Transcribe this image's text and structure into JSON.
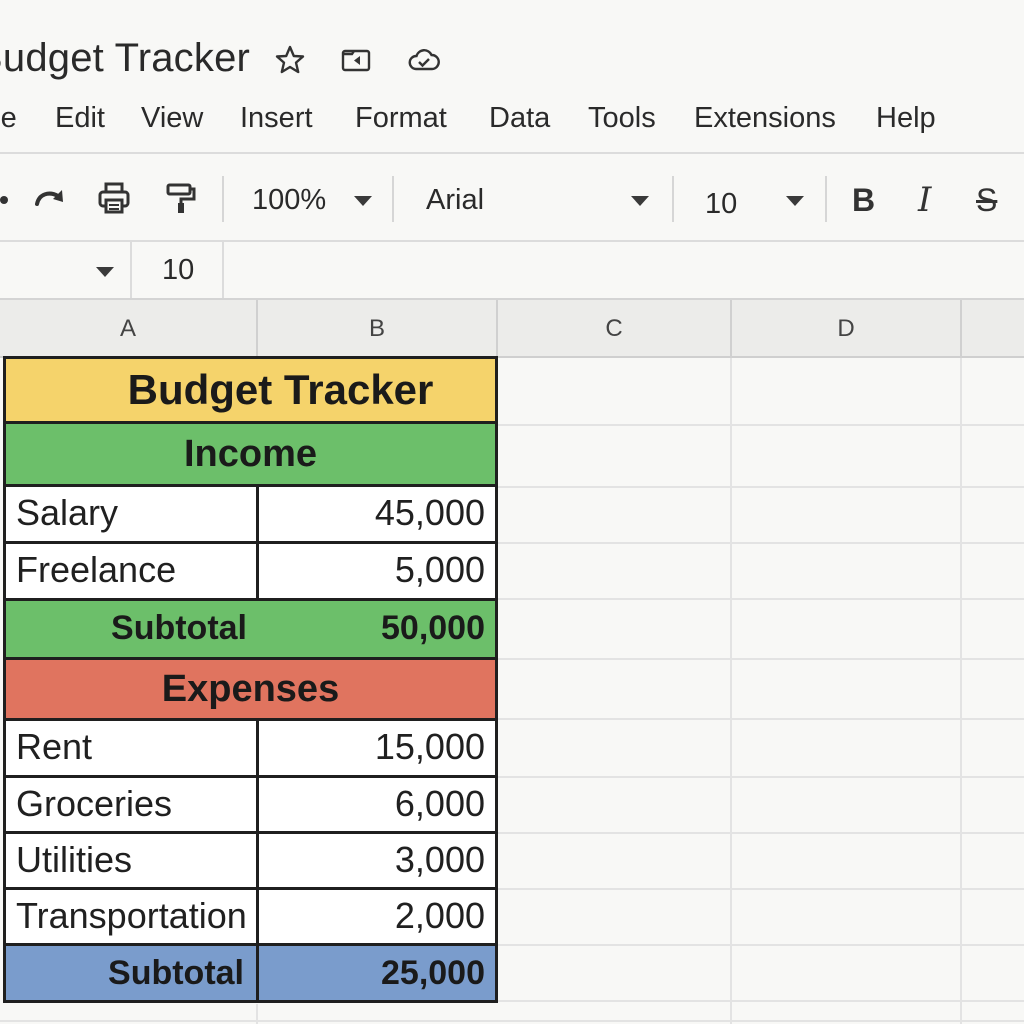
{
  "app": {
    "doc_title": "Budget Tracker",
    "title_icons": [
      "star-icon",
      "move-to-folder-icon",
      "cloud-saved-icon"
    ]
  },
  "menu": {
    "items": [
      "File",
      "Edit",
      "View",
      "Insert",
      "Format",
      "Data",
      "Tools",
      "Extensions",
      "Help"
    ]
  },
  "toolbar": {
    "icons": [
      "undo-icon",
      "redo-icon",
      "print-icon",
      "paint-format-icon"
    ],
    "zoom": "100%",
    "font_family": "Arial",
    "font_size": "10",
    "bold_label": "B",
    "italic_label": "I",
    "strikethrough_label": "S"
  },
  "formula_bar": {
    "cell_name": "",
    "value": "10"
  },
  "grid": {
    "columns": [
      "A",
      "B",
      "C",
      "D"
    ]
  },
  "budget": {
    "title": "Budget Tracker",
    "income_header": "Income",
    "income_rows": [
      {
        "label": "Salary",
        "value": "45,000"
      },
      {
        "label": "Freelance",
        "value": "5,000"
      }
    ],
    "income_subtotal": {
      "label": "Subtotal",
      "value": "50,000"
    },
    "expenses_header": "Expenses",
    "expense_rows": [
      {
        "label": "Rent",
        "value": "15,000"
      },
      {
        "label": "Groceries",
        "value": "6,000"
      },
      {
        "label": "Utilities",
        "value": "3,000"
      },
      {
        "label": "Transportation",
        "value": "2,000"
      }
    ],
    "expenses_subtotal": {
      "label": "Subtotal",
      "value": "25,000"
    }
  },
  "colors": {
    "title_fill": "#f5d36b",
    "income_fill": "#6cbf6a",
    "expenses_fill": "#e0745f",
    "expenses_subtotal_fill": "#7a9ccc"
  }
}
